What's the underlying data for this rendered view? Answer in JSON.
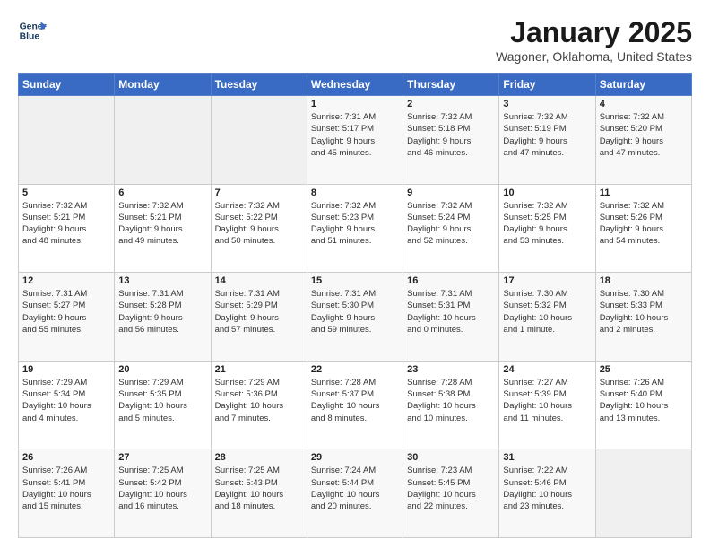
{
  "header": {
    "logo_line1": "General",
    "logo_line2": "Blue",
    "month": "January 2025",
    "location": "Wagoner, Oklahoma, United States"
  },
  "days_of_week": [
    "Sunday",
    "Monday",
    "Tuesday",
    "Wednesday",
    "Thursday",
    "Friday",
    "Saturday"
  ],
  "weeks": [
    [
      {
        "day": "",
        "info": ""
      },
      {
        "day": "",
        "info": ""
      },
      {
        "day": "",
        "info": ""
      },
      {
        "day": "1",
        "info": "Sunrise: 7:31 AM\nSunset: 5:17 PM\nDaylight: 9 hours\nand 45 minutes."
      },
      {
        "day": "2",
        "info": "Sunrise: 7:32 AM\nSunset: 5:18 PM\nDaylight: 9 hours\nand 46 minutes."
      },
      {
        "day": "3",
        "info": "Sunrise: 7:32 AM\nSunset: 5:19 PM\nDaylight: 9 hours\nand 47 minutes."
      },
      {
        "day": "4",
        "info": "Sunrise: 7:32 AM\nSunset: 5:20 PM\nDaylight: 9 hours\nand 47 minutes."
      }
    ],
    [
      {
        "day": "5",
        "info": "Sunrise: 7:32 AM\nSunset: 5:21 PM\nDaylight: 9 hours\nand 48 minutes."
      },
      {
        "day": "6",
        "info": "Sunrise: 7:32 AM\nSunset: 5:21 PM\nDaylight: 9 hours\nand 49 minutes."
      },
      {
        "day": "7",
        "info": "Sunrise: 7:32 AM\nSunset: 5:22 PM\nDaylight: 9 hours\nand 50 minutes."
      },
      {
        "day": "8",
        "info": "Sunrise: 7:32 AM\nSunset: 5:23 PM\nDaylight: 9 hours\nand 51 minutes."
      },
      {
        "day": "9",
        "info": "Sunrise: 7:32 AM\nSunset: 5:24 PM\nDaylight: 9 hours\nand 52 minutes."
      },
      {
        "day": "10",
        "info": "Sunrise: 7:32 AM\nSunset: 5:25 PM\nDaylight: 9 hours\nand 53 minutes."
      },
      {
        "day": "11",
        "info": "Sunrise: 7:32 AM\nSunset: 5:26 PM\nDaylight: 9 hours\nand 54 minutes."
      }
    ],
    [
      {
        "day": "12",
        "info": "Sunrise: 7:31 AM\nSunset: 5:27 PM\nDaylight: 9 hours\nand 55 minutes."
      },
      {
        "day": "13",
        "info": "Sunrise: 7:31 AM\nSunset: 5:28 PM\nDaylight: 9 hours\nand 56 minutes."
      },
      {
        "day": "14",
        "info": "Sunrise: 7:31 AM\nSunset: 5:29 PM\nDaylight: 9 hours\nand 57 minutes."
      },
      {
        "day": "15",
        "info": "Sunrise: 7:31 AM\nSunset: 5:30 PM\nDaylight: 9 hours\nand 59 minutes."
      },
      {
        "day": "16",
        "info": "Sunrise: 7:31 AM\nSunset: 5:31 PM\nDaylight: 10 hours\nand 0 minutes."
      },
      {
        "day": "17",
        "info": "Sunrise: 7:30 AM\nSunset: 5:32 PM\nDaylight: 10 hours\nand 1 minute."
      },
      {
        "day": "18",
        "info": "Sunrise: 7:30 AM\nSunset: 5:33 PM\nDaylight: 10 hours\nand 2 minutes."
      }
    ],
    [
      {
        "day": "19",
        "info": "Sunrise: 7:29 AM\nSunset: 5:34 PM\nDaylight: 10 hours\nand 4 minutes."
      },
      {
        "day": "20",
        "info": "Sunrise: 7:29 AM\nSunset: 5:35 PM\nDaylight: 10 hours\nand 5 minutes."
      },
      {
        "day": "21",
        "info": "Sunrise: 7:29 AM\nSunset: 5:36 PM\nDaylight: 10 hours\nand 7 minutes."
      },
      {
        "day": "22",
        "info": "Sunrise: 7:28 AM\nSunset: 5:37 PM\nDaylight: 10 hours\nand 8 minutes."
      },
      {
        "day": "23",
        "info": "Sunrise: 7:28 AM\nSunset: 5:38 PM\nDaylight: 10 hours\nand 10 minutes."
      },
      {
        "day": "24",
        "info": "Sunrise: 7:27 AM\nSunset: 5:39 PM\nDaylight: 10 hours\nand 11 minutes."
      },
      {
        "day": "25",
        "info": "Sunrise: 7:26 AM\nSunset: 5:40 PM\nDaylight: 10 hours\nand 13 minutes."
      }
    ],
    [
      {
        "day": "26",
        "info": "Sunrise: 7:26 AM\nSunset: 5:41 PM\nDaylight: 10 hours\nand 15 minutes."
      },
      {
        "day": "27",
        "info": "Sunrise: 7:25 AM\nSunset: 5:42 PM\nDaylight: 10 hours\nand 16 minutes."
      },
      {
        "day": "28",
        "info": "Sunrise: 7:25 AM\nSunset: 5:43 PM\nDaylight: 10 hours\nand 18 minutes."
      },
      {
        "day": "29",
        "info": "Sunrise: 7:24 AM\nSunset: 5:44 PM\nDaylight: 10 hours\nand 20 minutes."
      },
      {
        "day": "30",
        "info": "Sunrise: 7:23 AM\nSunset: 5:45 PM\nDaylight: 10 hours\nand 22 minutes."
      },
      {
        "day": "31",
        "info": "Sunrise: 7:22 AM\nSunset: 5:46 PM\nDaylight: 10 hours\nand 23 minutes."
      },
      {
        "day": "",
        "info": ""
      }
    ]
  ]
}
